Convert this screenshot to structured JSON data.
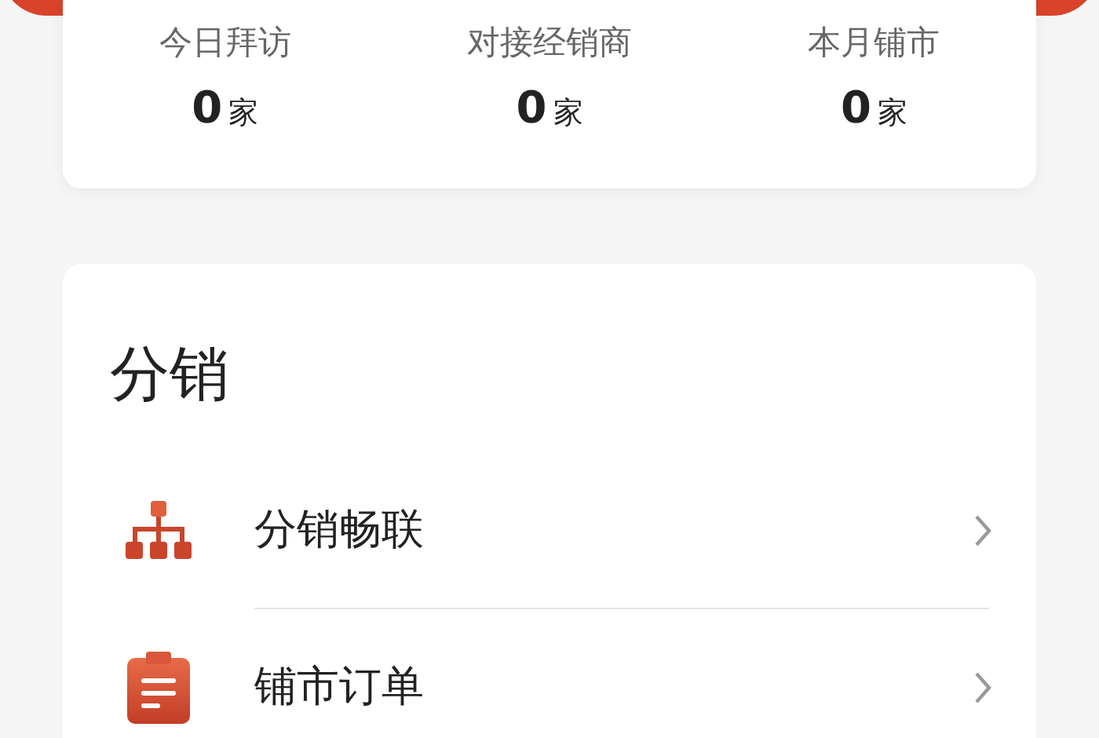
{
  "stats": [
    {
      "label": "今日拜访",
      "value": "0",
      "unit": "家"
    },
    {
      "label": "对接经销商",
      "value": "0",
      "unit": "家"
    },
    {
      "label": "本月铺市",
      "value": "0",
      "unit": "家"
    }
  ],
  "section": {
    "title": "分销",
    "items": [
      {
        "label": "分销畅联",
        "kind": "hierarchy"
      },
      {
        "label": "铺市订单",
        "kind": "clipboard"
      }
    ]
  }
}
